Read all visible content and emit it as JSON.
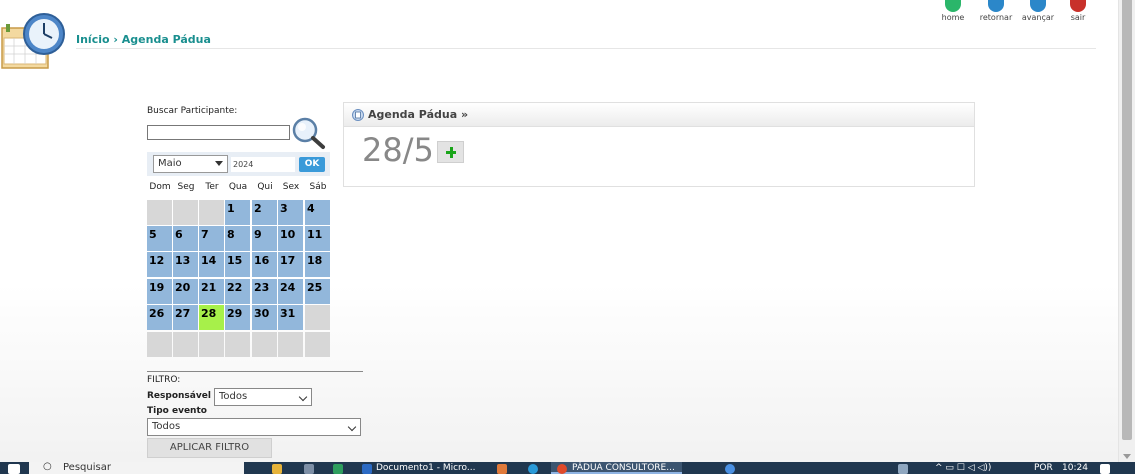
{
  "header": {
    "breadcrumb_home": "Início",
    "breadcrumb_sep": "›",
    "breadcrumb_current": "Agenda Pádua"
  },
  "topnav": {
    "home": "home",
    "back": "retornar",
    "forward": "avançar",
    "exit": "sair"
  },
  "search": {
    "label": "Buscar Participante:",
    "value": ""
  },
  "calendar": {
    "month": "Maio",
    "year": "2024",
    "ok_label": "OK",
    "weekdays": [
      "Dom",
      "Seg",
      "Ter",
      "Qua",
      "Qui",
      "Sex",
      "Sáb"
    ],
    "weeks": [
      [
        "",
        "",
        "",
        "1",
        "2",
        "3",
        "4"
      ],
      [
        "5",
        "6",
        "7",
        "8",
        "9",
        "10",
        "11"
      ],
      [
        "12",
        "13",
        "14",
        "15",
        "16",
        "17",
        "18"
      ],
      [
        "19",
        "20",
        "21",
        "22",
        "23",
        "24",
        "25"
      ],
      [
        "26",
        "27",
        "28",
        "29",
        "30",
        "31",
        ""
      ],
      [
        "",
        "",
        "",
        "",
        "",
        "",
        ""
      ]
    ],
    "selected_day": "28",
    "colors": {
      "day": "#92b7db",
      "empty": "#d7d7d7",
      "selected": "#a7f04a"
    }
  },
  "filter": {
    "title": "FILTRO:",
    "responsavel_label": "Responsável",
    "responsavel_value": "Todos",
    "tipo_label": "Tipo evento",
    "tipo_value": "Todos",
    "apply_label": "APLICAR FILTRO"
  },
  "agenda": {
    "title": "Agenda Pádua »",
    "date": "28/5"
  },
  "taskbar": {
    "search_placeholder": "Pesquisar",
    "app1": "Documento1 - Micro...",
    "app2": "PÁDUA CONSULTORE...",
    "lang": "POR",
    "time": "10:24"
  }
}
